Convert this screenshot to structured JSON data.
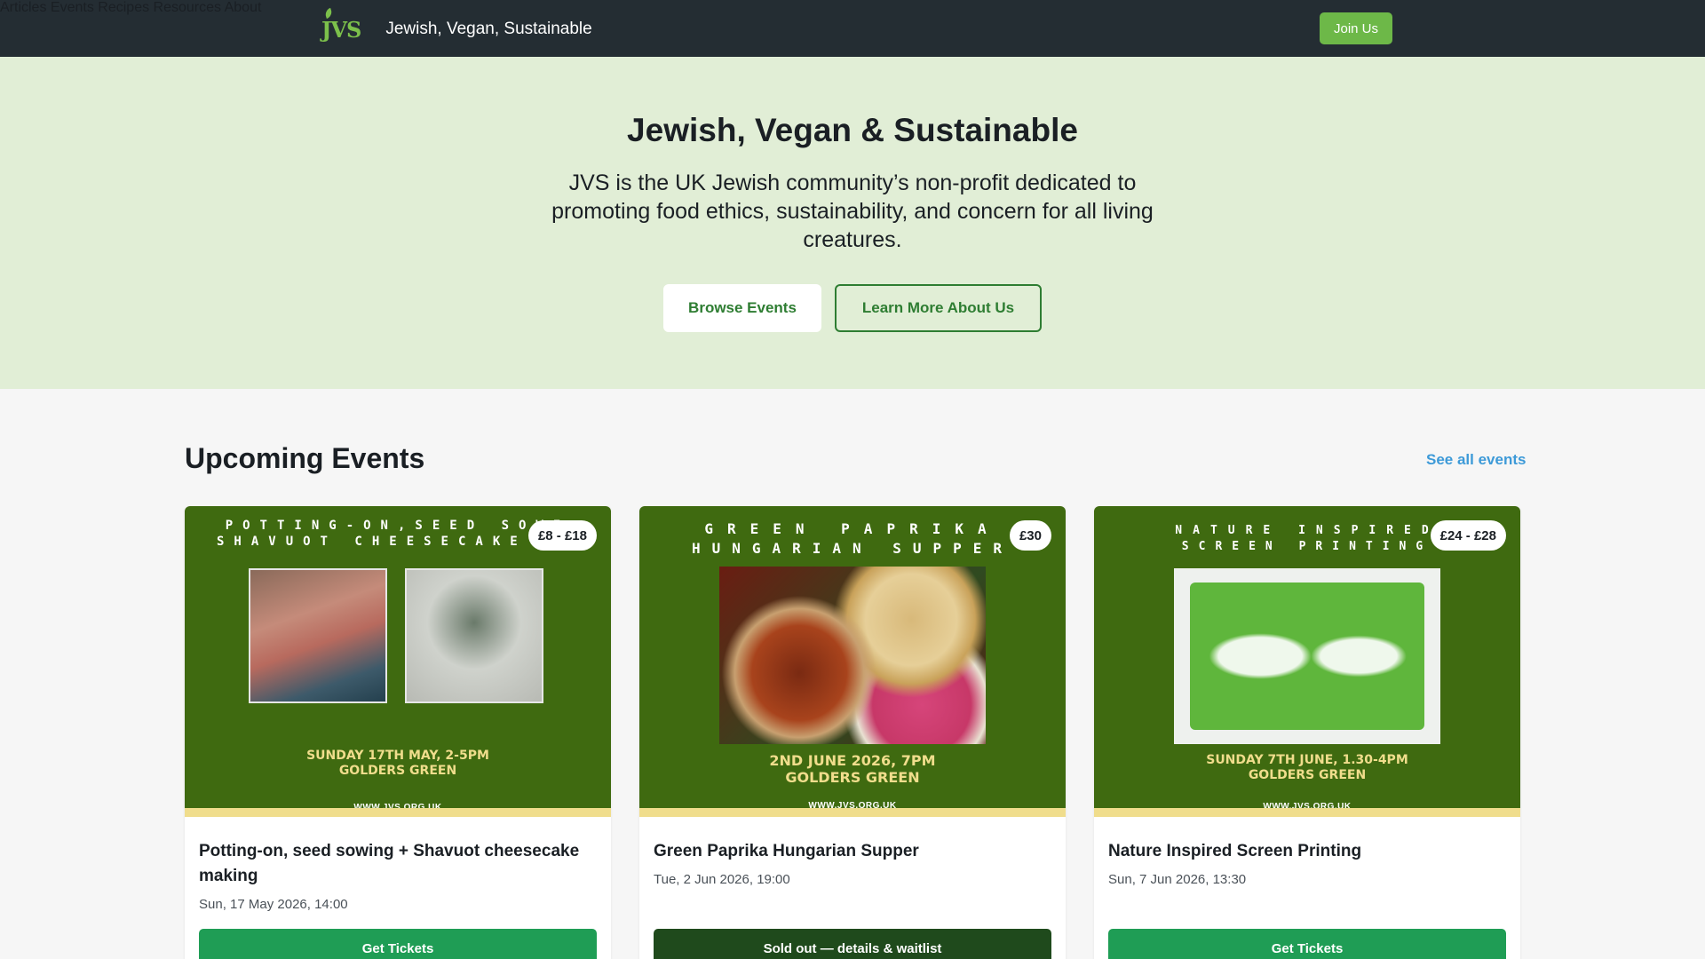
{
  "header": {
    "logo_text": "JVS",
    "site_title": "Jewish, Vegan, Sustainable",
    "nav": [
      "Articles",
      "Events",
      "Recipes",
      "Resources",
      "About"
    ],
    "join_label": "Join Us"
  },
  "hero": {
    "title": "Jewish, Vegan & Sustainable",
    "description": "JVS is the UK Jewish community’s non-profit dedicated to promoting food ethics, sustainability, and concern for all living creatures.",
    "browse_label": "Browse Events",
    "learn_label": "Learn More About Us"
  },
  "events": {
    "heading": "Upcoming Events",
    "see_all_label": "See all events",
    "cards": [
      {
        "poster_line1": "POTTING-ON,SEED SOWI",
        "poster_line2": "SHAVUOT CHEESECAKE MA",
        "poster_date1": "SUNDAY 17TH MAY, 2-5PM",
        "poster_date2": "GOLDERS GREEN",
        "poster_url": "WWW.JVS.ORG.UK",
        "price": "£8 - £18",
        "title": "Potting-on, seed sowing + Shavuot cheesecake making",
        "date": "Sun, 17 May 2026, 14:00",
        "button": "Get Tickets"
      },
      {
        "poster_line1": "GREEN PAPRIKA",
        "poster_line2": "HUNGARIAN SUPPER",
        "poster_date1": "2ND JUNE 2026, 7PM",
        "poster_date2": "GOLDERS GREEN",
        "poster_url": "WWW.JVS.ORG.UK",
        "price": "£30",
        "title": "Green Paprika Hungarian Supper",
        "date": "Tue, 2 Jun 2026, 19:00",
        "button": "Sold out — details & waitlist"
      },
      {
        "poster_line1": "NATURE INSPIRED",
        "poster_line2": "SCREEN PRINTING",
        "poster_date1": "SUNDAY 7TH JUNE, 1.30-4PM",
        "poster_date2": "GOLDERS GREEN",
        "poster_url": "WWW.JVS.ORG.UK",
        "price": "£24 - £28",
        "title": "Nature Inspired Screen Printing",
        "date": "Sun, 7 Jun 2026, 13:30",
        "button": "Get Tickets"
      }
    ]
  },
  "colors": {
    "header_bg": "#242d33",
    "hero_bg": "#e1eed6",
    "accent_green": "#6db848",
    "ticket_green": "#1f9d55",
    "soldout_green": "#1f4a1c",
    "link_blue": "#3d9ad8"
  }
}
